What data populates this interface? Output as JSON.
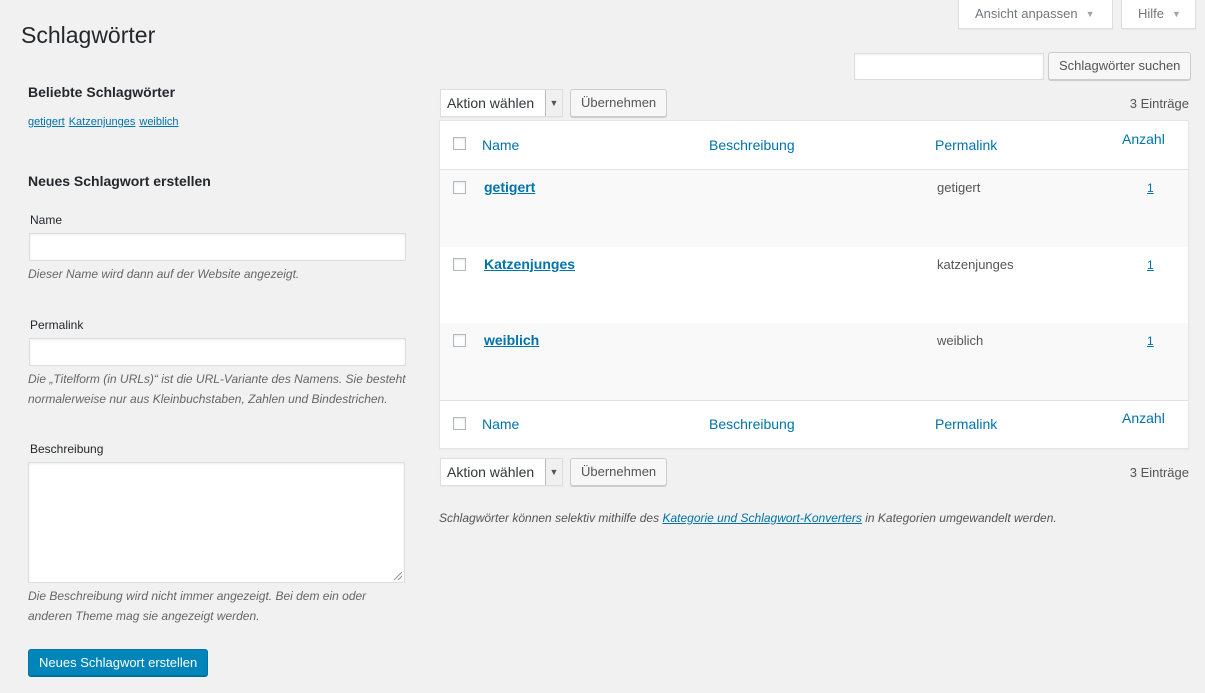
{
  "screen_meta": {
    "options_label": "Ansicht anpassen",
    "help_label": "Hilfe"
  },
  "page_title": "Schlagwörter",
  "search": {
    "value": "",
    "button_label": "Schlagwörter suchen"
  },
  "popular": {
    "heading": "Beliebte Schlagwörter",
    "tags": [
      "getigert",
      "Katzenjunges",
      "weiblich"
    ]
  },
  "add_form": {
    "heading": "Neues Schlagwort erstellen",
    "name_label": "Name",
    "name_value": "",
    "name_help": "Dieser Name wird dann auf der Website angezeigt.",
    "slug_label": "Permalink",
    "slug_value": "",
    "slug_help_line1": "Die „Titelform (in URLs)“ ist die URL-Variante des Namens. Sie besteht",
    "slug_help_line2": "normalerweise nur aus Kleinbuchstaben, Zahlen und Bindestrichen.",
    "description_label": "Beschreibung",
    "description_value": "",
    "description_help_line1": "Die Beschreibung wird nicht immer angezeigt. Bei dem ein oder",
    "description_help_line2": "anderen Theme mag sie angezeigt werden.",
    "submit_label": "Neues Schlagwort erstellen"
  },
  "bulk": {
    "selected": "Aktion wählen",
    "apply_label": "Übernehmen",
    "count_label": "3 Einträge"
  },
  "table": {
    "columns": {
      "name": "Name",
      "description": "Beschreibung",
      "slug": "Permalink",
      "count": "Anzahl"
    },
    "rows": [
      {
        "name": "getigert",
        "description": "",
        "slug": "getigert",
        "count": "1"
      },
      {
        "name": "Katzenjunges",
        "description": "",
        "slug": "katzenjunges",
        "count": "1"
      },
      {
        "name": "weiblich",
        "description": "",
        "slug": "weiblich",
        "count": "1"
      }
    ]
  },
  "footnote": {
    "before": "Schlagwörter können selektiv mithilfe des ",
    "link": "Kategorie und Schlagwort-Konverters",
    "after": " in Kategorien umgewandelt werden."
  }
}
